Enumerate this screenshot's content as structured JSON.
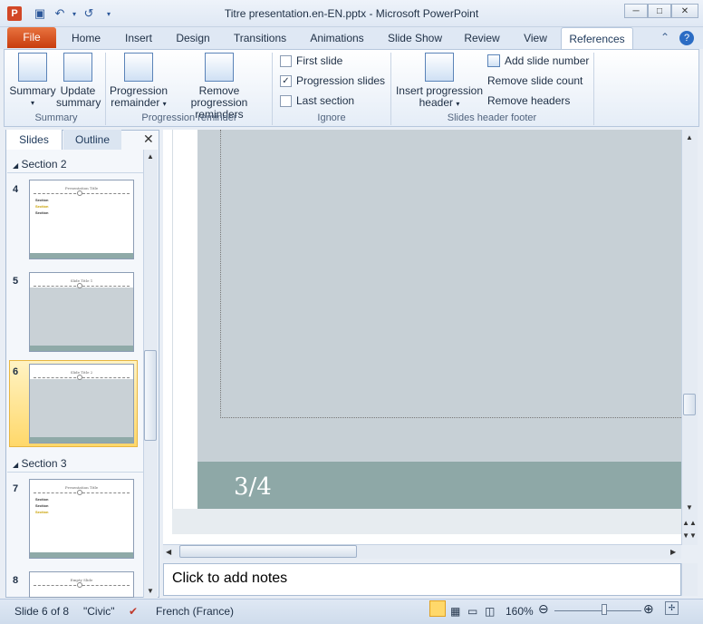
{
  "window": {
    "title": "Titre presentation.en-EN.pptx  -  Microsoft PowerPoint"
  },
  "tabs": [
    "File",
    "Home",
    "Insert",
    "Design",
    "Transitions",
    "Animations",
    "Slide Show",
    "Review",
    "View",
    "References"
  ],
  "ribbon": {
    "summary_group": {
      "label": "Summary",
      "summary": "Summary",
      "update_1": "Update",
      "update_2": "summary"
    },
    "progression_group": {
      "label": "Progression reminder",
      "prog_1": "Progression",
      "prog_2": "remainder",
      "remove_1": "Remove progression",
      "remove_2": "reminders"
    },
    "ignore_group": {
      "label": "Ignore",
      "first": "First slide",
      "progression": "Progression slides",
      "last": "Last section",
      "first_checked": false,
      "progression_checked": true,
      "last_checked": false
    },
    "header_group": {
      "label": "Slides header  footer",
      "insert_1": "Insert progression",
      "insert_2": "header",
      "add_num": "Add slide number",
      "remove_count": "Remove slide count",
      "remove_headers": "Remove headers"
    }
  },
  "left_pane": {
    "tab_slides": "Slides",
    "tab_outline": "Outline",
    "section2": "Section 2",
    "section3": "Section 3",
    "slides": [
      {
        "num": "4",
        "title": "Presentation Title"
      },
      {
        "num": "5",
        "title": "Slide Title 1"
      },
      {
        "num": "6",
        "title": "Slide Title 2"
      },
      {
        "num": "7",
        "title": "Presentation Title"
      },
      {
        "num": "8",
        "title": "Empty Slide"
      }
    ],
    "bullet": "Section"
  },
  "slide": {
    "page": "3/4"
  },
  "notes": {
    "placeholder": "Click to add notes"
  },
  "status": {
    "slide": "Slide 6 of 8",
    "theme": "\"Civic\"",
    "language": "French (France)",
    "zoom": "160%"
  }
}
